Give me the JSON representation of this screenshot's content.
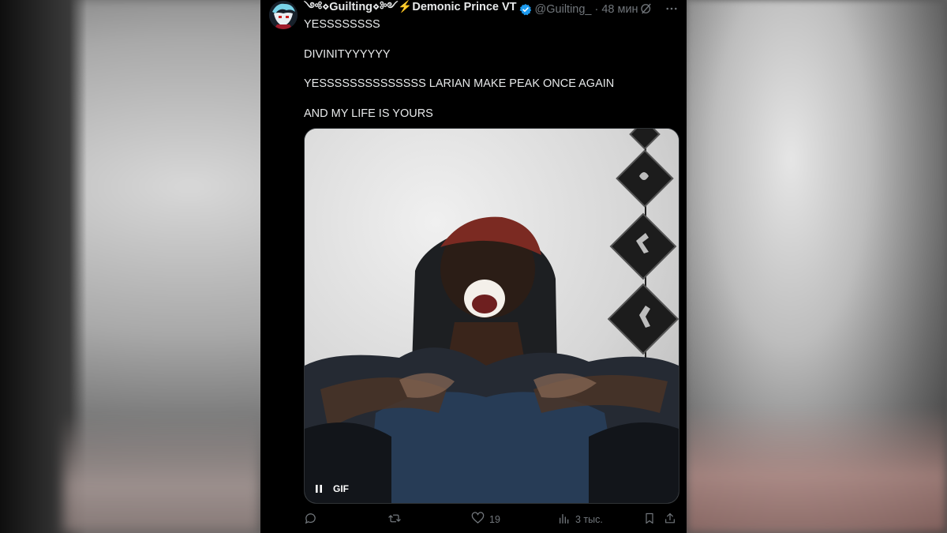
{
  "author": {
    "display_name": "༺⋄Guilting⋄༻⚡Demonic Prince VT",
    "handle": "@Guilting_",
    "separator": "·",
    "time": "48 мин",
    "verified_color": "#1d9bf0"
  },
  "tweet": {
    "lines": [
      "YESSSSSSSS",
      "DIVINITYYYYYY",
      "YESSSSSSSSSSSSSS LARIAN MAKE PEAK ONCE AGAIN",
      "AND MY LIFE IS YOURS"
    ]
  },
  "media": {
    "badge": "GIF",
    "alt_icons": [
      "pause-icon"
    ]
  },
  "actions": {
    "reply_count": "",
    "retweet_count": "",
    "like_count": "19",
    "views_count": "3 тыс.",
    "bookmark_count": "",
    "share_count": ""
  },
  "icons": {
    "grok": "grok-icon",
    "more": "more-icon",
    "reply": "reply-icon",
    "retweet": "retweet-icon",
    "like": "heart-icon",
    "views": "views-icon",
    "bookmark": "bookmark-icon",
    "share": "share-icon"
  },
  "colors": {
    "background": "#000000",
    "text": "#e7e9ea",
    "secondary": "#71767b"
  }
}
